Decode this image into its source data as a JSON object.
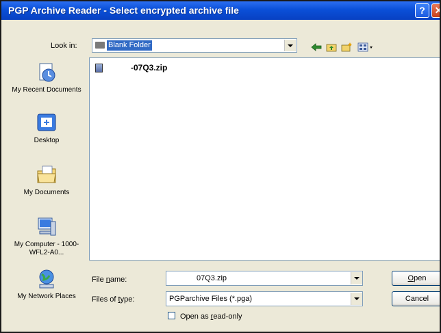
{
  "window": {
    "title": "PGP Archive Reader - Select encrypted archive file",
    "help_glyph": "?",
    "close_glyph": "✕"
  },
  "look_in": {
    "label": "Look in:",
    "value": "Blank Folder"
  },
  "toolbar": {
    "icons": [
      "back-icon",
      "up-folder-icon",
      "new-folder-icon",
      "view-menu-icon"
    ]
  },
  "places": [
    {
      "name": "recent",
      "label": "My Recent Documents",
      "icon": "recent-documents-icon"
    },
    {
      "name": "desktop",
      "label": "Desktop",
      "icon": "desktop-icon"
    },
    {
      "name": "documents",
      "label": "My Documents",
      "icon": "my-documents-icon"
    },
    {
      "name": "computer",
      "label": "My Computer - 1000-WFL2-A0...",
      "icon": "my-computer-icon"
    },
    {
      "name": "network",
      "label": "My Network Places",
      "icon": "network-places-icon"
    }
  ],
  "files": [
    {
      "name": "-07Q3.zip",
      "icon": "zip-file-icon"
    }
  ],
  "file_name": {
    "label": "File name:",
    "value": "07Q3.zip"
  },
  "file_type": {
    "label": "Files of type:",
    "value": "PGParchive Files (*.pga)"
  },
  "read_only": {
    "label": "Open as read-only",
    "checked": false
  },
  "buttons": {
    "open": "Open",
    "cancel": "Cancel"
  },
  "colors": {
    "title_bar": "#0a4fd8",
    "selection": "#316ac5",
    "dialog_bg": "#ece9d8"
  }
}
